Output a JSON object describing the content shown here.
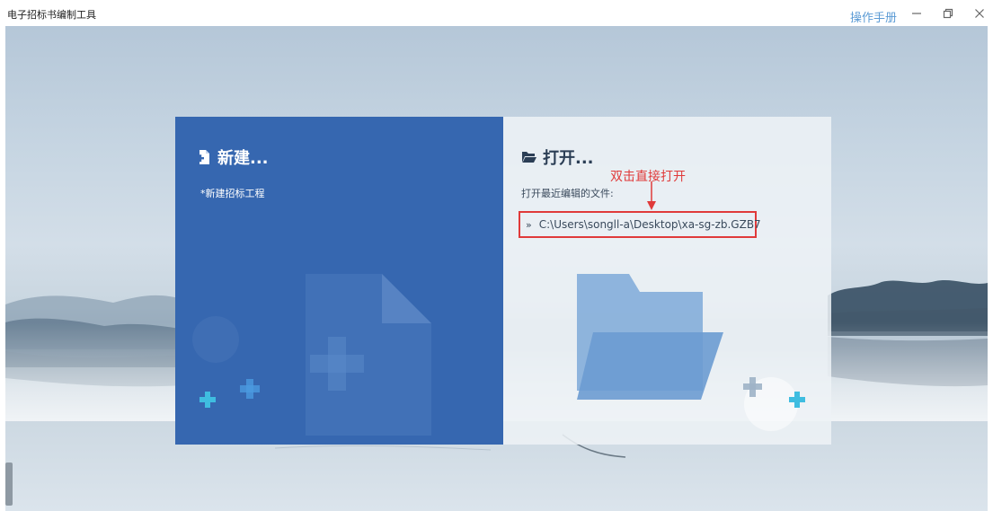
{
  "app": {
    "title": "电子招标书编制工具",
    "manual_link": "操作手册"
  },
  "window_controls": {
    "minimize": "—",
    "maximize": "❐",
    "close": "✕"
  },
  "new_panel": {
    "title": "新建...",
    "items": [
      "*新建招标工程"
    ],
    "icon": "new-file-icon"
  },
  "open_panel": {
    "title": "打开...",
    "recent_label": "打开最近编辑的文件:",
    "recent_files": [
      {
        "prefix": "»",
        "path": "C:\\Users\\songll-a\\Desktop\\xa-sg-zb.GZB7"
      }
    ],
    "icon": "folder-icon"
  },
  "annotation": {
    "text": "双击直接打开",
    "color": "#e03a3a"
  },
  "colors": {
    "new_panel": "#3667b0",
    "open_panel": "#eef2f6",
    "accent_link": "#5b9bd5",
    "plus_cyan": "#3fbde0"
  }
}
